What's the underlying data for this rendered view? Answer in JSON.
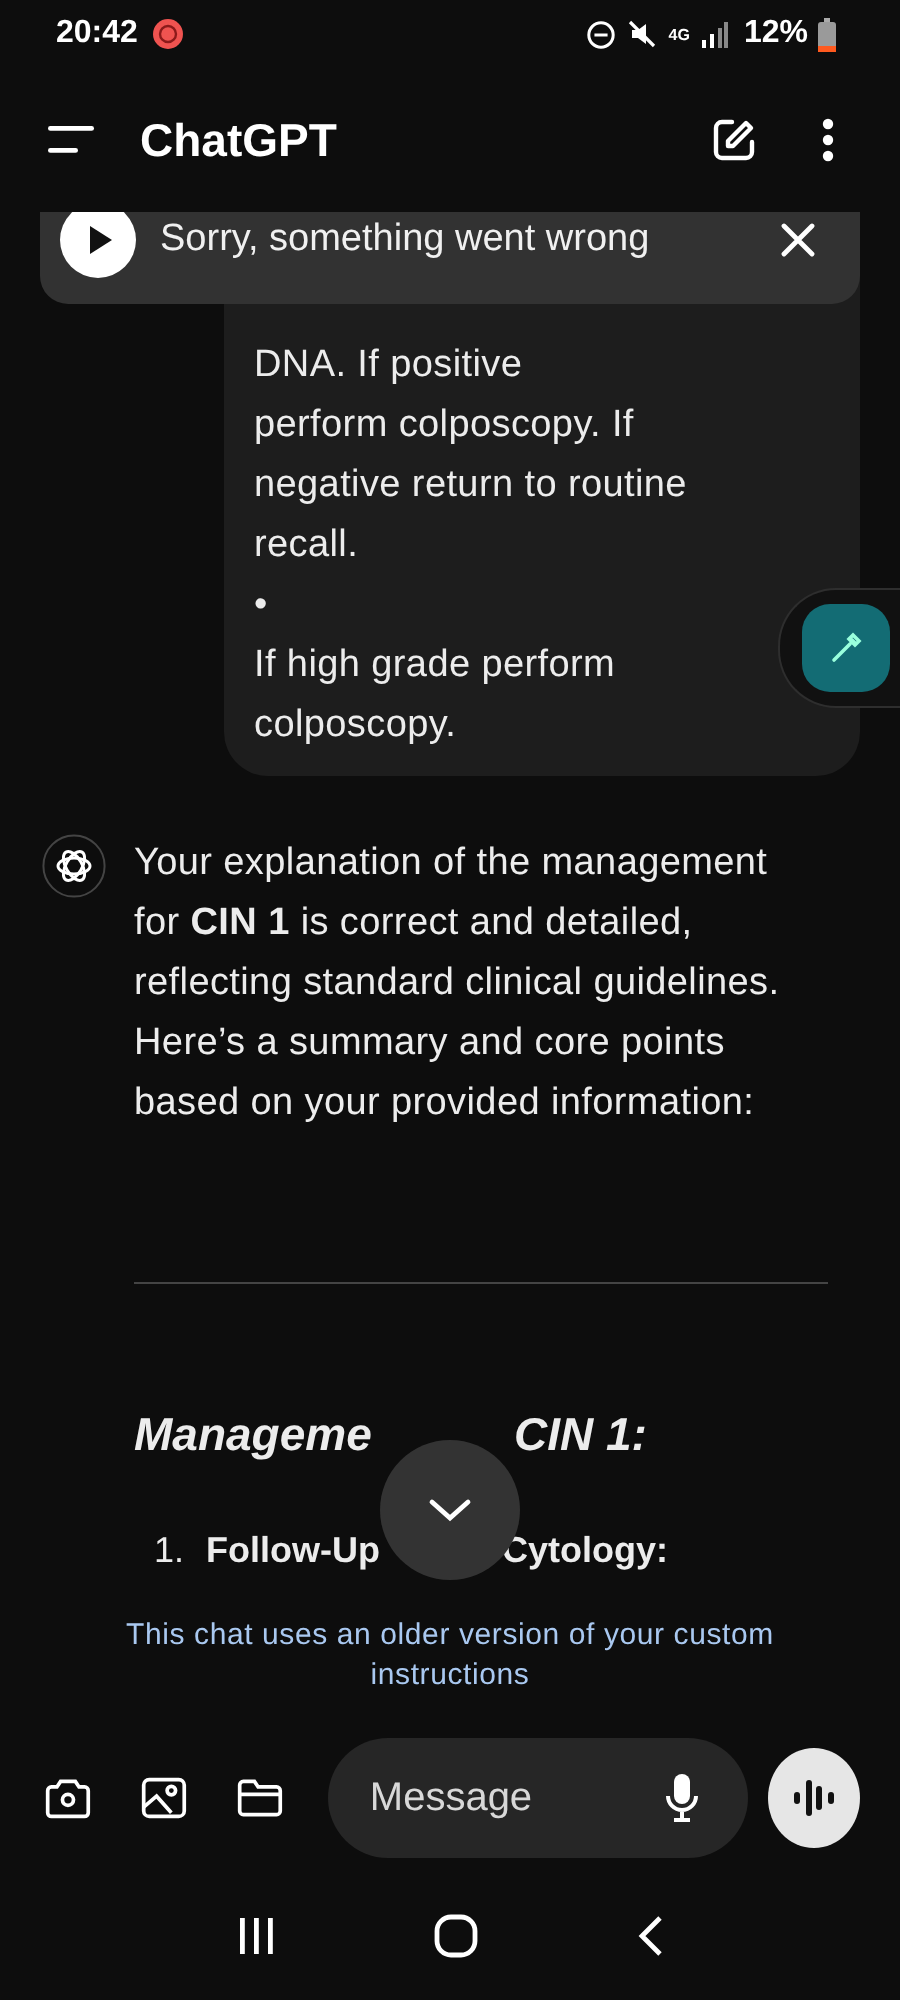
{
  "status_bar": {
    "time": "20:42",
    "network": "4G",
    "battery": "12%"
  },
  "header": {
    "title": "ChatGPT"
  },
  "toast": {
    "message": "Sorry, something went wrong"
  },
  "user_message": {
    "lines": [
      "DNA. If positive",
      "perform colposcopy. If",
      "negative return to routine",
      "recall.",
      "•",
      "If high grade perform",
      "colposcopy."
    ]
  },
  "assistant_message": {
    "text": "Your explanation of the management for **CIN 1** is correct and detailed, reflecting standard clinical guidelines. Here’s a summary and core points based on your provided information:",
    "heading_parts": [
      "Manageme",
      "CIN 1:"
    ],
    "list": [
      {
        "number": "1.",
        "title_parts": [
          "Follow-Up",
          "Cytology"
        ],
        "suffix": ":"
      }
    ]
  },
  "notice": "This chat uses an older version of your custom instructions",
  "composer": {
    "placeholder": "Message"
  }
}
